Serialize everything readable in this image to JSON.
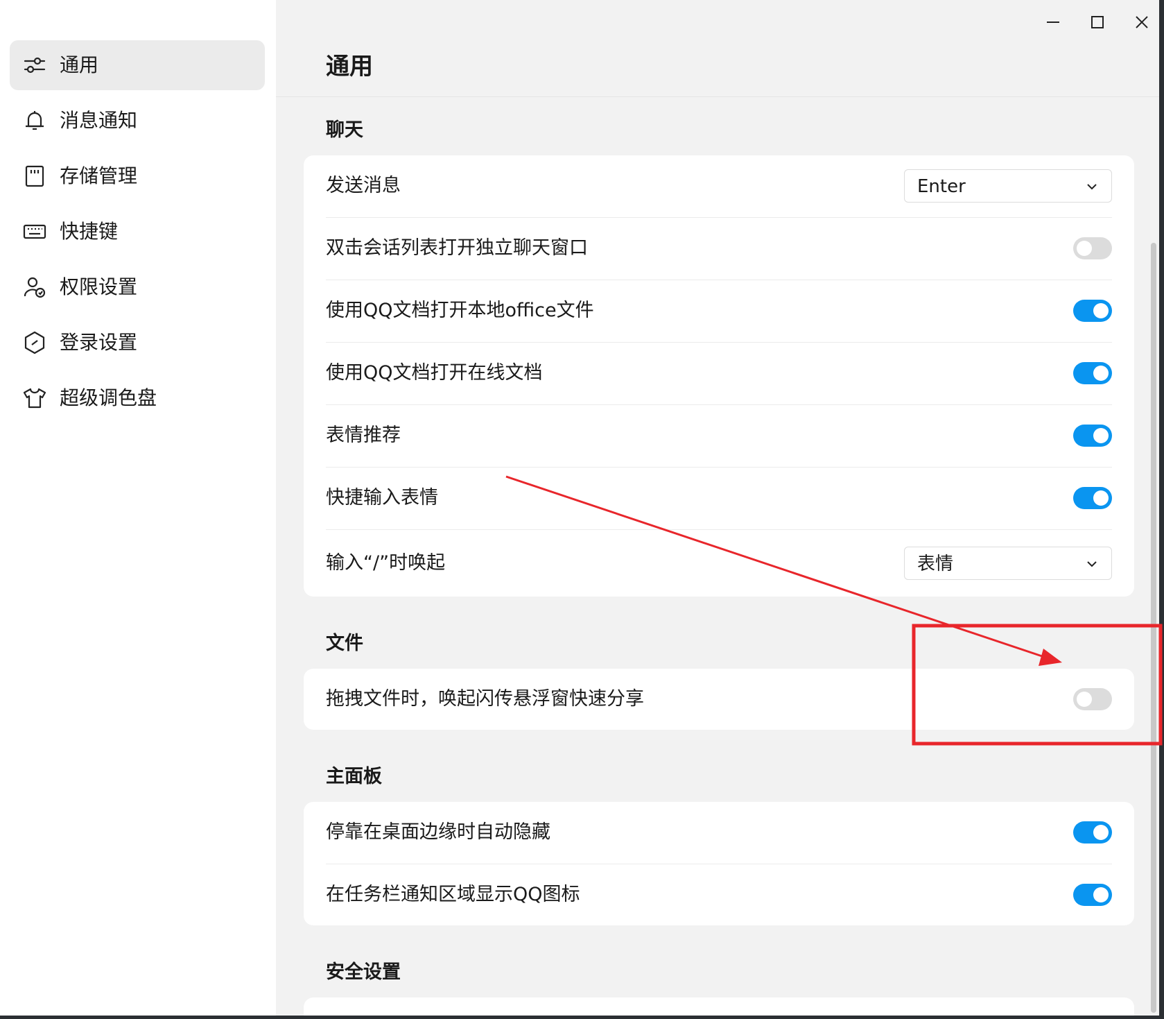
{
  "sidebar": {
    "items": [
      {
        "label": "通用",
        "icon": "sliders-icon",
        "active": true
      },
      {
        "label": "消息通知",
        "icon": "bell-icon",
        "active": false
      },
      {
        "label": "存储管理",
        "icon": "storage-card-icon",
        "active": false
      },
      {
        "label": "快捷键",
        "icon": "keyboard-icon",
        "active": false
      },
      {
        "label": "权限设置",
        "icon": "user-shield-icon",
        "active": false
      },
      {
        "label": "登录设置",
        "icon": "hexagon-lock-icon",
        "active": false
      },
      {
        "label": "超级调色盘",
        "icon": "tshirt-icon",
        "active": false
      }
    ]
  },
  "window_controls": {
    "minimize": "minimize-icon",
    "maximize": "maximize-icon",
    "close": "close-icon"
  },
  "page": {
    "title": "通用"
  },
  "sections": {
    "chat": {
      "title": "聊天",
      "send_message": {
        "label": "发送消息",
        "value": "Enter"
      },
      "rows": [
        {
          "label": "双击会话列表打开独立聊天窗口",
          "on": false
        },
        {
          "label": "使用QQ文档打开本地office文件",
          "on": true
        },
        {
          "label": "使用QQ文档打开在线文档",
          "on": true
        },
        {
          "label": "表情推荐",
          "on": true
        },
        {
          "label": "快捷输入表情",
          "on": true
        }
      ],
      "slash_trigger": {
        "label": "输入“/”时唤起",
        "value": "表情"
      }
    },
    "file": {
      "title": "文件",
      "rows": [
        {
          "label": "拖拽文件时，唤起闪传悬浮窗快速分享",
          "on": false
        }
      ]
    },
    "main_panel": {
      "title": "主面板",
      "rows": [
        {
          "label": "停靠在桌面边缘时自动隐藏",
          "on": true
        },
        {
          "label": "在任务栏通知区域显示QQ图标",
          "on": true
        }
      ]
    },
    "security": {
      "title": "安全设置"
    }
  },
  "colors": {
    "toggle_on": "#0a95f0",
    "toggle_off": "#dcdcdc",
    "annotation": "#e8262b"
  }
}
